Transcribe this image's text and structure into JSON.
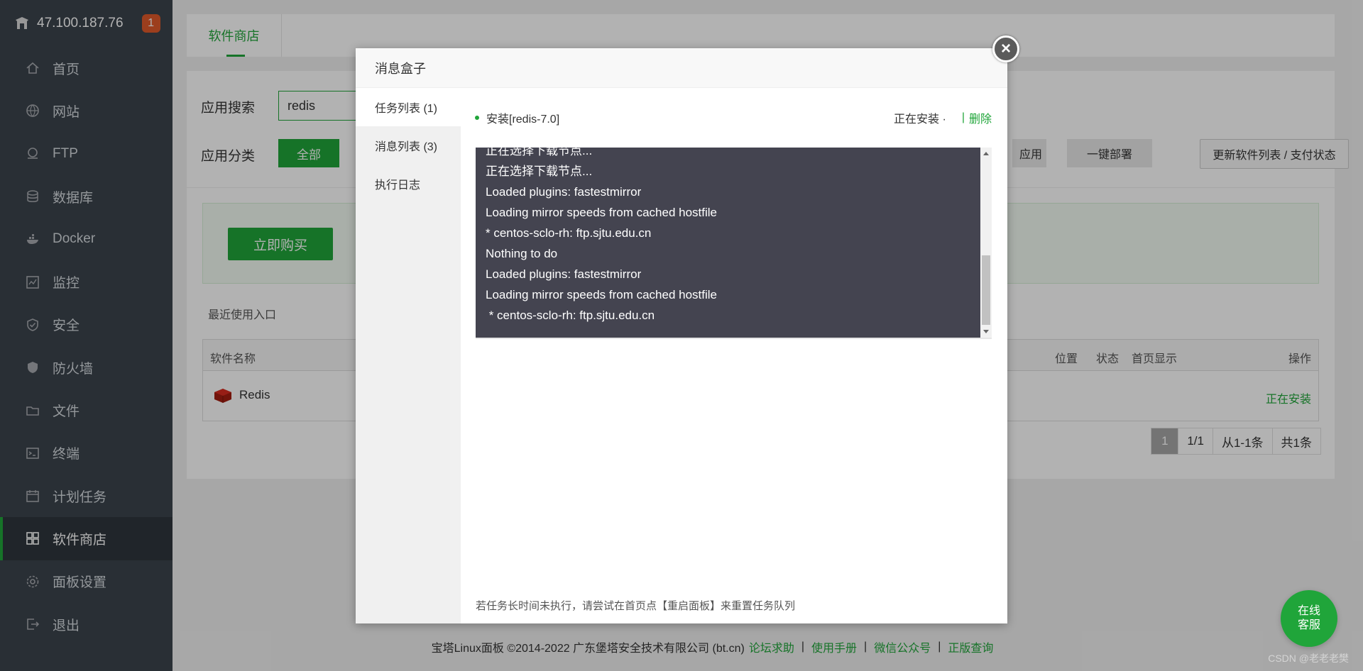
{
  "sidebar": {
    "server_ip": "47.100.187.76",
    "notification_count": "1",
    "items": [
      {
        "label": "首页",
        "icon": "home-icon"
      },
      {
        "label": "网站",
        "icon": "globe-icon"
      },
      {
        "label": "FTP",
        "icon": "ftp-icon"
      },
      {
        "label": "数据库",
        "icon": "database-icon"
      },
      {
        "label": "Docker",
        "icon": "docker-icon"
      },
      {
        "label": "监控",
        "icon": "monitor-icon"
      },
      {
        "label": "安全",
        "icon": "shield-check-icon"
      },
      {
        "label": "防火墙",
        "icon": "firewall-icon"
      },
      {
        "label": "文件",
        "icon": "folder-icon"
      },
      {
        "label": "终端",
        "icon": "terminal-icon"
      },
      {
        "label": "计划任务",
        "icon": "calendar-icon"
      },
      {
        "label": "软件商店",
        "icon": "grid-icon",
        "active": true
      },
      {
        "label": "面板设置",
        "icon": "gear-icon"
      },
      {
        "label": "退出",
        "icon": "logout-icon"
      }
    ]
  },
  "store": {
    "tab_label": "软件商店",
    "search_label": "应用搜索",
    "search_value": "redis",
    "category_label": "应用分类",
    "category_all": "全部",
    "partial_app_button": "应用",
    "one_click_deploy": "一键部署",
    "refresh_button": "更新软件列表 / 支付状态",
    "buy_button": "立即购买",
    "recent_label": "最近使用入口",
    "columns": {
      "name": "软件名称",
      "location": "位置",
      "status": "状态",
      "homepage": "首页显示",
      "action": "操作"
    },
    "row": {
      "name": "Redis",
      "status": "正在安装"
    },
    "pager": {
      "current": "1",
      "pages": "1/1",
      "range": "从1-1条",
      "total": "共1条"
    }
  },
  "footer": {
    "copyright": "宝塔Linux面板 ©2014-2022 广东堡塔安全技术有限公司 (bt.cn)",
    "links": [
      "论坛求助",
      "使用手册",
      "微信公众号",
      "正版查询"
    ]
  },
  "modal": {
    "title": "消息盒子",
    "tabs": [
      "任务列表 (1)",
      "消息列表 (3)",
      "执行日志"
    ],
    "task_name": "安装[redis-7.0]",
    "task_status": "正在安装 ·",
    "task_pipe": "|",
    "task_delete": "删除",
    "console_lines": [
      "正在选择下载节点...",
      "正在选择下载节点...",
      "Loaded plugins: fastestmirror",
      "Loading mirror speeds from cached hostfile",
      "* centos-sclo-rh: ftp.sjtu.edu.cn",
      "Nothing to do",
      "Loaded plugins: fastestmirror",
      "Loading mirror speeds from cached hostfile",
      " * centos-sclo-rh: ftp.sjtu.edu.cn"
    ],
    "hint": "若任务长时间未执行，请尝试在首页点【重启面板】来重置任务队列"
  },
  "chat": {
    "line1": "在线",
    "line2": "客服"
  },
  "watermark": "CSDN @老老老樊",
  "colors": {
    "accent": "#20a53a",
    "sidebar": "#3c444d",
    "console": "#444450"
  }
}
